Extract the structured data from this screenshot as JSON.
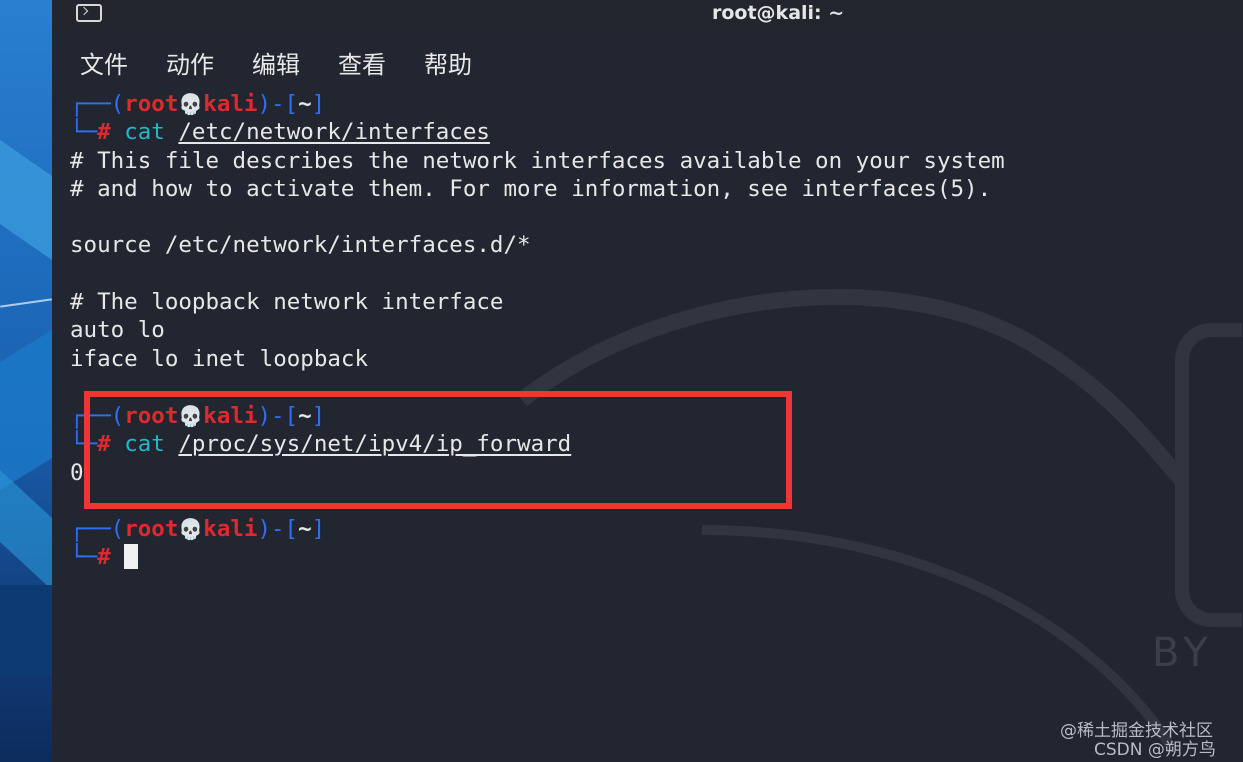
{
  "window": {
    "title": "root@kali: ~",
    "icon": "terminal-icon"
  },
  "menu": [
    "文件",
    "动作",
    "编辑",
    "查看",
    "帮助"
  ],
  "prompt": {
    "open": "┌──(",
    "user": "root",
    "skull": "💀",
    "host": "kali",
    "close": ")-[",
    "dir": "~",
    "end": "]",
    "corner": "└─",
    "hash": "#"
  },
  "blocks": [
    {
      "command": "cat",
      "arg": "/etc/network/interfaces",
      "output": [
        "# This file describes the network interfaces available on your system",
        "# and how to activate them. For more information, see interfaces(5).",
        "",
        "source /etc/network/interfaces.d/*",
        "",
        "# The loopback network interface",
        "auto lo",
        "iface lo inet loopback"
      ]
    },
    {
      "command": "cat",
      "arg": "/proc/sys/net/ipv4/ip_forward",
      "output": [
        "0"
      ]
    }
  ],
  "background_text": "BY",
  "watermarks": {
    "line1": "@稀土掘金技术社区",
    "line2": "CSDN @朔方鸟"
  },
  "colors": {
    "prompt_bracket": "#2f6ff6",
    "prompt_user": "#e0282e",
    "command": "#22b8c8",
    "highlight_box": "#ef3535"
  }
}
